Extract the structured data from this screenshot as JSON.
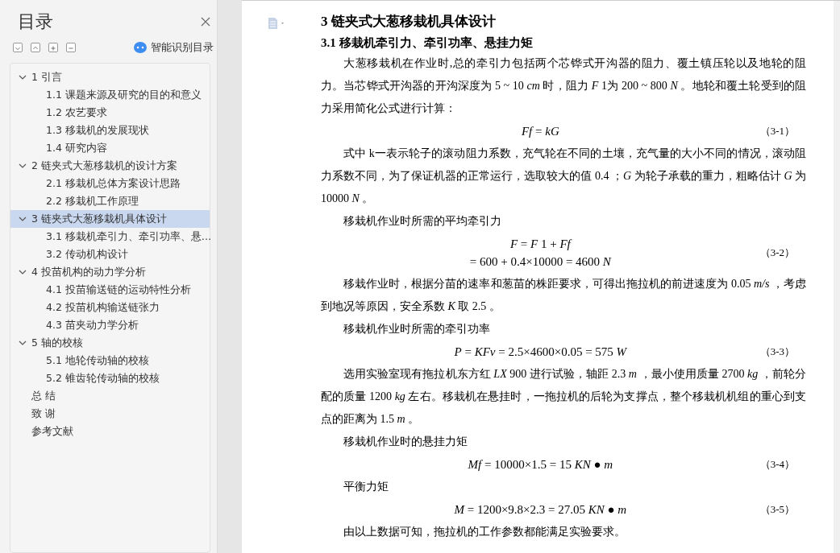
{
  "sidebar": {
    "title": "目录",
    "smart_toc_label": "智能识别目录",
    "items": [
      {
        "label": "1 引言",
        "expanded": true,
        "selected": false,
        "children": [
          {
            "label": "1.1 课题来源及研究的目的和意义",
            "selected": false
          },
          {
            "label": "1.2 农艺要求",
            "selected": false
          },
          {
            "label": "1.3 移栽机的发展现状",
            "selected": false
          },
          {
            "label": "1.4 研究内容",
            "selected": false
          }
        ]
      },
      {
        "label": "2  链夹式大葱移栽机的设计方案",
        "expanded": true,
        "selected": false,
        "children": [
          {
            "label": "2.1 移栽机总体方案设计思路",
            "selected": false
          },
          {
            "label": "2.2 移栽机工作原理",
            "selected": false
          }
        ]
      },
      {
        "label": "3  链夹式大葱移栽机具体设计",
        "expanded": true,
        "selected": true,
        "children": [
          {
            "label": "3.1 移栽机牵引力、牵引功率、悬…",
            "selected": false
          },
          {
            "label": "3.2 传动机构设计",
            "selected": false
          }
        ]
      },
      {
        "label": "4  投苗机构的动力学分析",
        "expanded": true,
        "selected": false,
        "children": [
          {
            "label": "4.1 投苗输送链的运动特性分析",
            "selected": false
          },
          {
            "label": "4.2 投苗机构输送链张力",
            "selected": false
          },
          {
            "label": "4.3 苗夹动力学分析",
            "selected": false
          }
        ]
      },
      {
        "label": "5  轴的校核",
        "expanded": true,
        "selected": false,
        "children": [
          {
            "label": "5.1 地轮传动轴的校核",
            "selected": false
          },
          {
            "label": "5.2 锥齿轮传动轴的校核",
            "selected": false
          }
        ]
      },
      {
        "label": "总  结",
        "selected": false
      },
      {
        "label": "致  谢",
        "selected": false
      },
      {
        "label": "参考文献",
        "selected": false
      }
    ]
  },
  "document": {
    "blocks": [
      {
        "kind": "heading1",
        "text": "3  链夹式大葱移栽机具体设计"
      },
      {
        "kind": "heading2",
        "text": "3.1 移栽机牵引力、牵引功率、悬挂力矩"
      },
      {
        "kind": "para",
        "text": "大葱移栽机在作业时,总的牵引力包括两个芯铧式开沟器的阻力、覆土镇压轮以及地轮的阻力。当芯铧式开沟器的开沟深度为  5 ~ 10 *cm*  时，阻力 *F* 1为 200 ~ 800 *N* 。地轮和覆土轮受到的阻力采用简化公式进行计算："
      },
      {
        "kind": "equation",
        "lines": [
          "*Ff* = *kG*"
        ],
        "number": "（3-1）"
      },
      {
        "kind": "para",
        "text": "式中  k一表示轮子的滚动阻力系数，充气轮在不同的土壤，充气量的大小不同的情况，滚动阻力系数不同，为了保证机器的正常运行，选取较大的值  0.4 ；*G*  为轮子承载的重力，粗略估计 *G* 为 10000 *N* 。"
      },
      {
        "kind": "para",
        "text": "移栽机作业时所需的平均牵引力"
      },
      {
        "kind": "equation",
        "lines": [
          "*F* = *F* 1 + *Ff*",
          "= 600 + 0.4×10000 = 4600 *N*"
        ],
        "number": "（3-2）"
      },
      {
        "kind": "para",
        "text": "移栽作业时，根据分苗的速率和葱苗的株距要求，可得出拖拉机的前进速度为 0.05 *m/s* ，考虑到地况等原因，安全系数  *K*  取 2.5 。"
      },
      {
        "kind": "para",
        "text": "移栽机作业时所需的牵引功率"
      },
      {
        "kind": "equation",
        "lines": [
          "*P* = *KFv* = 2.5×4600×0.05 = 575 *W*"
        ],
        "number": "（3-3）"
      },
      {
        "kind": "para",
        "text": "选用实验室现有拖拉机东方红 *LX* 900 进行试验，轴距 2.3 *m* ，最小使用质量  2700 *kg* ，前轮分配的质量 1200 *kg*  左右。移栽机在悬挂时，一拖拉机的后轮为支撑点，整个移栽机机组的重心到支点的距离为 1.5 *m* 。"
      },
      {
        "kind": "para",
        "text": "移栽机作业时的悬挂力矩"
      },
      {
        "kind": "equation",
        "lines": [
          "*Mf* = 10000×1.5 = 15 *KN* ● *m*"
        ],
        "number": "（3-4）"
      },
      {
        "kind": "para",
        "text": "平衡力矩"
      },
      {
        "kind": "equation",
        "lines": [
          "*M* = 1200×9.8×2.3 = 27.05 *KN* ● *m*"
        ],
        "number": "（3-5）"
      },
      {
        "kind": "para",
        "text": "由以上数据可知，拖拉机的工作参数都能满足实验要求。"
      }
    ]
  }
}
